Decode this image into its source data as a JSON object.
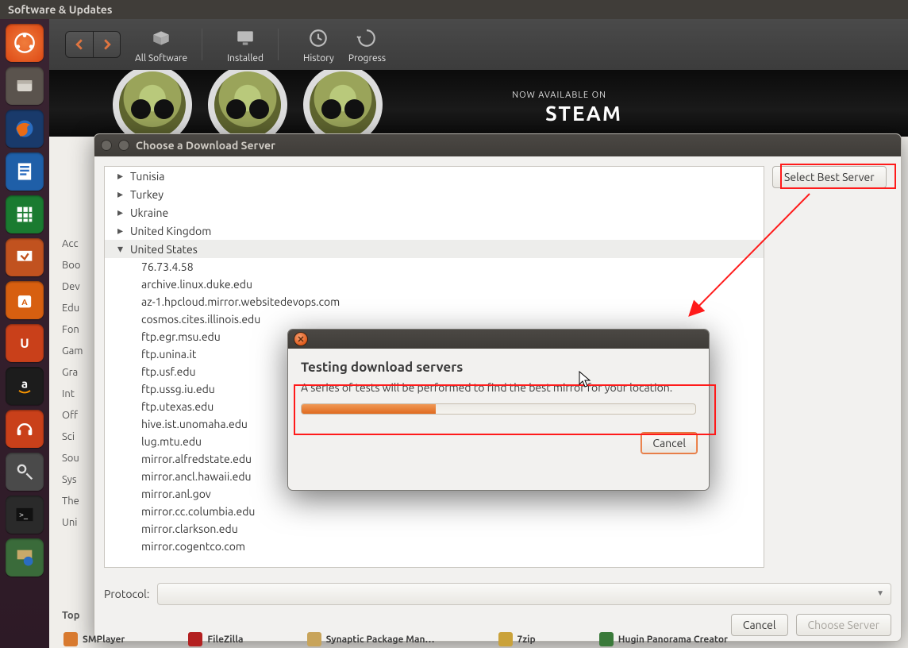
{
  "menubar": {
    "title": "Software & Updates"
  },
  "usc_toolbar": {
    "all": "All Software",
    "installed": "Installed",
    "history": "History",
    "progress": "Progress"
  },
  "banner": {
    "now": "NOW AVAILABLE ON",
    "steam": "STEAM"
  },
  "side_labels": [
    "Acc",
    "Boo",
    "Dev",
    "Edu",
    "Fon",
    "Gam",
    "Gra",
    "Int",
    "Off",
    "Sci",
    "Sou",
    "Sys",
    "The",
    "Uni"
  ],
  "top_rated": "Top",
  "dlg1": {
    "title": "Choose a Download Server",
    "select_best": "Select Best Server",
    "protocol_label": "Protocol:",
    "cancel": "Cancel",
    "choose": "Choose Server",
    "countries": [
      "Tunisia",
      "Turkey",
      "Ukraine",
      "United Kingdom",
      "United States"
    ],
    "servers": [
      "76.73.4.58",
      "archive.linux.duke.edu",
      "az-1.hpcloud.mirror.websitedevops.com",
      "cosmos.cites.illinois.edu",
      "ftp.egr.msu.edu",
      "ftp.unina.it",
      "ftp.usf.edu",
      "ftp.ussg.iu.edu",
      "ftp.utexas.edu",
      "hive.ist.unomaha.edu",
      "lug.mtu.edu",
      "mirror.alfredstate.edu",
      "mirror.ancl.hawaii.edu",
      "mirror.anl.gov",
      "mirror.cc.columbia.edu",
      "mirror.clarkson.edu",
      "mirror.cogentco.com"
    ]
  },
  "dlg2": {
    "heading": "Testing download servers",
    "desc": "A series of tests will be performed to find the best mirror for your location.",
    "progress_percent": 34,
    "cancel": "Cancel"
  },
  "taskbar": {
    "smplayer": "SMPlayer",
    "filezilla": "FileZilla",
    "synaptic": "Synaptic Package Man…",
    "sevenzip": "7zip",
    "hugin": "Hugin Panorama Creator"
  }
}
